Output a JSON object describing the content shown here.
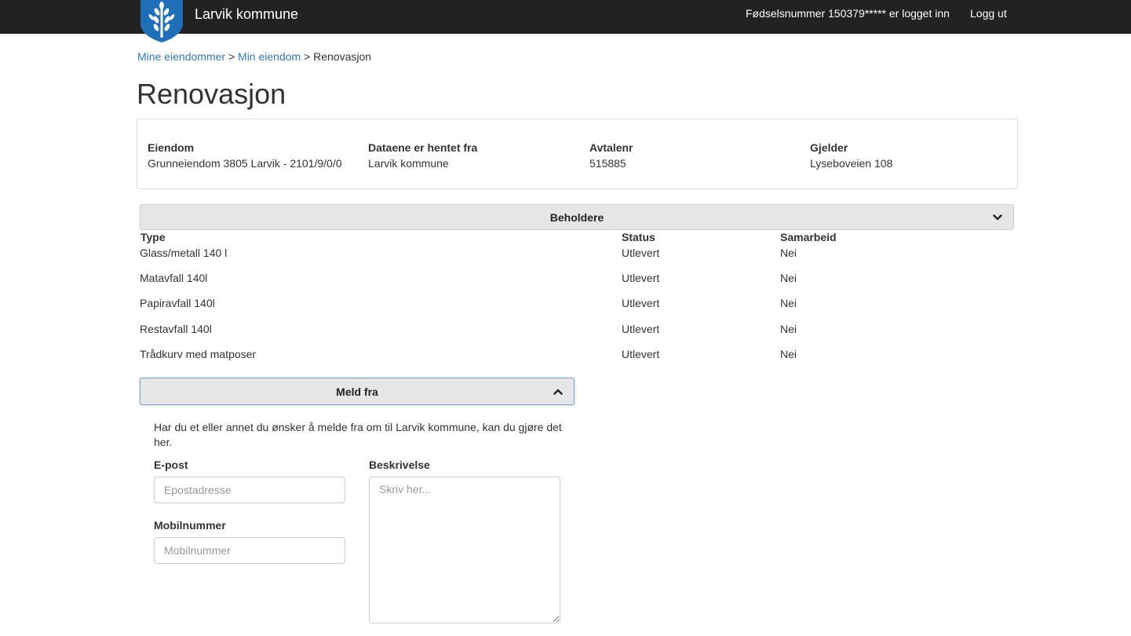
{
  "header": {
    "brand": "Larvik kommune",
    "login_status": "Fødselsnummer 150379***** er logget inn",
    "logout": "Logg ut",
    "logo_icon": "wheat-shield-icon",
    "logo_color": "#1e6fb8"
  },
  "breadcrumb": {
    "items": [
      "Mine eiendommer",
      "Min eiendom"
    ],
    "separator": ">",
    "current": "Renovasjon"
  },
  "page": {
    "title": "Renovasjon"
  },
  "info": {
    "eiendom": {
      "label": "Eiendom",
      "value": "Grunneiendom 3805 Larvik - 2101/9/0/0"
    },
    "kilde": {
      "label": "Dataene er hentet fra",
      "value": "Larvik kommune"
    },
    "avtale": {
      "label": "Avtalenr",
      "value": "515885"
    },
    "gjelder": {
      "label": "Gjelder",
      "value": "Lyseboveien 108"
    }
  },
  "beholdere": {
    "title": "Beholdere",
    "icon": "chevron-down-icon",
    "columns": [
      "Type",
      "Status",
      "Samarbeid"
    ],
    "rows": [
      {
        "type": "Glass/metall 140 l",
        "status": "Utlevert",
        "samarbeid": "Nei"
      },
      {
        "type": "Matavfall 140l",
        "status": "Utlevert",
        "samarbeid": "Nei"
      },
      {
        "type": "Papiravfall 140l",
        "status": "Utlevert",
        "samarbeid": "Nei"
      },
      {
        "type": "Restavfall 140l",
        "status": "Utlevert",
        "samarbeid": "Nei"
      },
      {
        "type": "Trådkurv med matposer",
        "status": "Utlevert",
        "samarbeid": "Nei"
      }
    ]
  },
  "meld_fra": {
    "title": "Meld fra",
    "icon": "chevron-up-icon",
    "intro": "Har du et eller annet du ønsker å melde fra om til Larvik kommune, kan du gjøre det her.",
    "epost": {
      "label": "E-post",
      "placeholder": "Epostadresse"
    },
    "mobil": {
      "label": "Mobilnummer",
      "placeholder": "Mobilnummer"
    },
    "beskrivelse": {
      "label": "Beskrivelse",
      "placeholder": "Skriv her..."
    }
  },
  "colors": {
    "topbar": "#222222",
    "link": "#337ab7",
    "accordion": "#e6e6e6"
  }
}
